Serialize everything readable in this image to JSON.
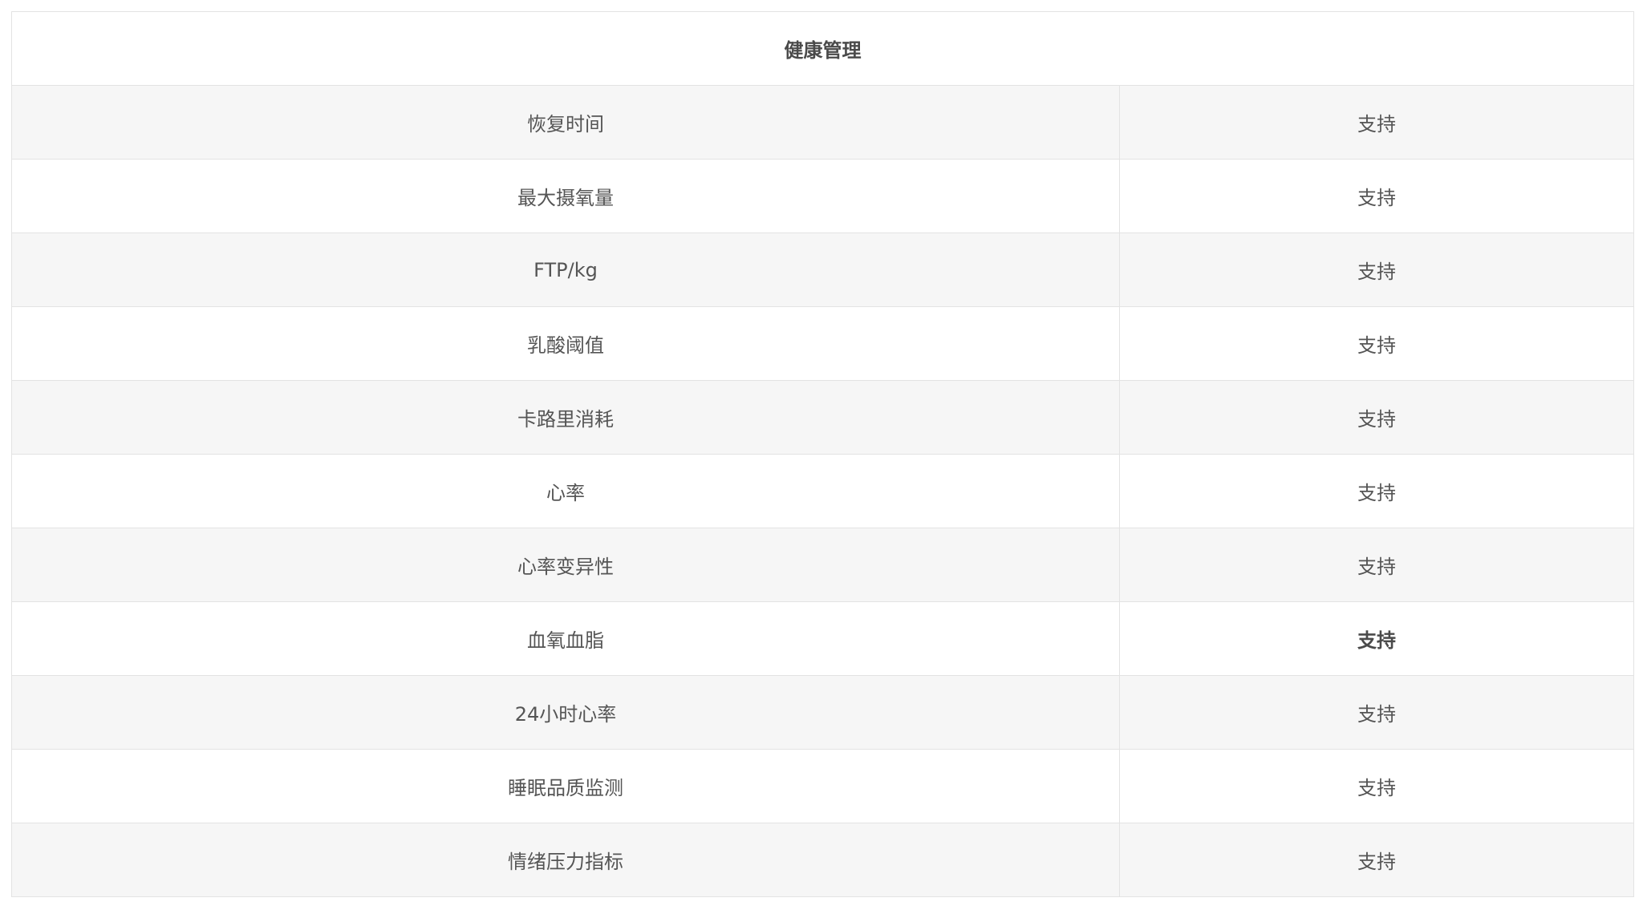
{
  "section_title": "健康管理",
  "rows": [
    {
      "feature": "恢复时间",
      "value": "支持",
      "bold": false
    },
    {
      "feature": "最大摄氧量",
      "value": "支持",
      "bold": false
    },
    {
      "feature": "FTP/kg",
      "value": "支持",
      "bold": false
    },
    {
      "feature": "乳酸阈值",
      "value": "支持",
      "bold": false
    },
    {
      "feature": "卡路里消耗",
      "value": "支持",
      "bold": false
    },
    {
      "feature": "心率",
      "value": "支持",
      "bold": false
    },
    {
      "feature": "心率变异性",
      "value": "支持",
      "bold": false
    },
    {
      "feature": "血氧血脂",
      "value": "支持",
      "bold": true
    },
    {
      "feature": "24小时心率",
      "value": "支持",
      "bold": false
    },
    {
      "feature": "睡眠品质监测",
      "value": "支持",
      "bold": false
    },
    {
      "feature": "情绪压力指标",
      "value": "支持",
      "bold": false
    }
  ]
}
